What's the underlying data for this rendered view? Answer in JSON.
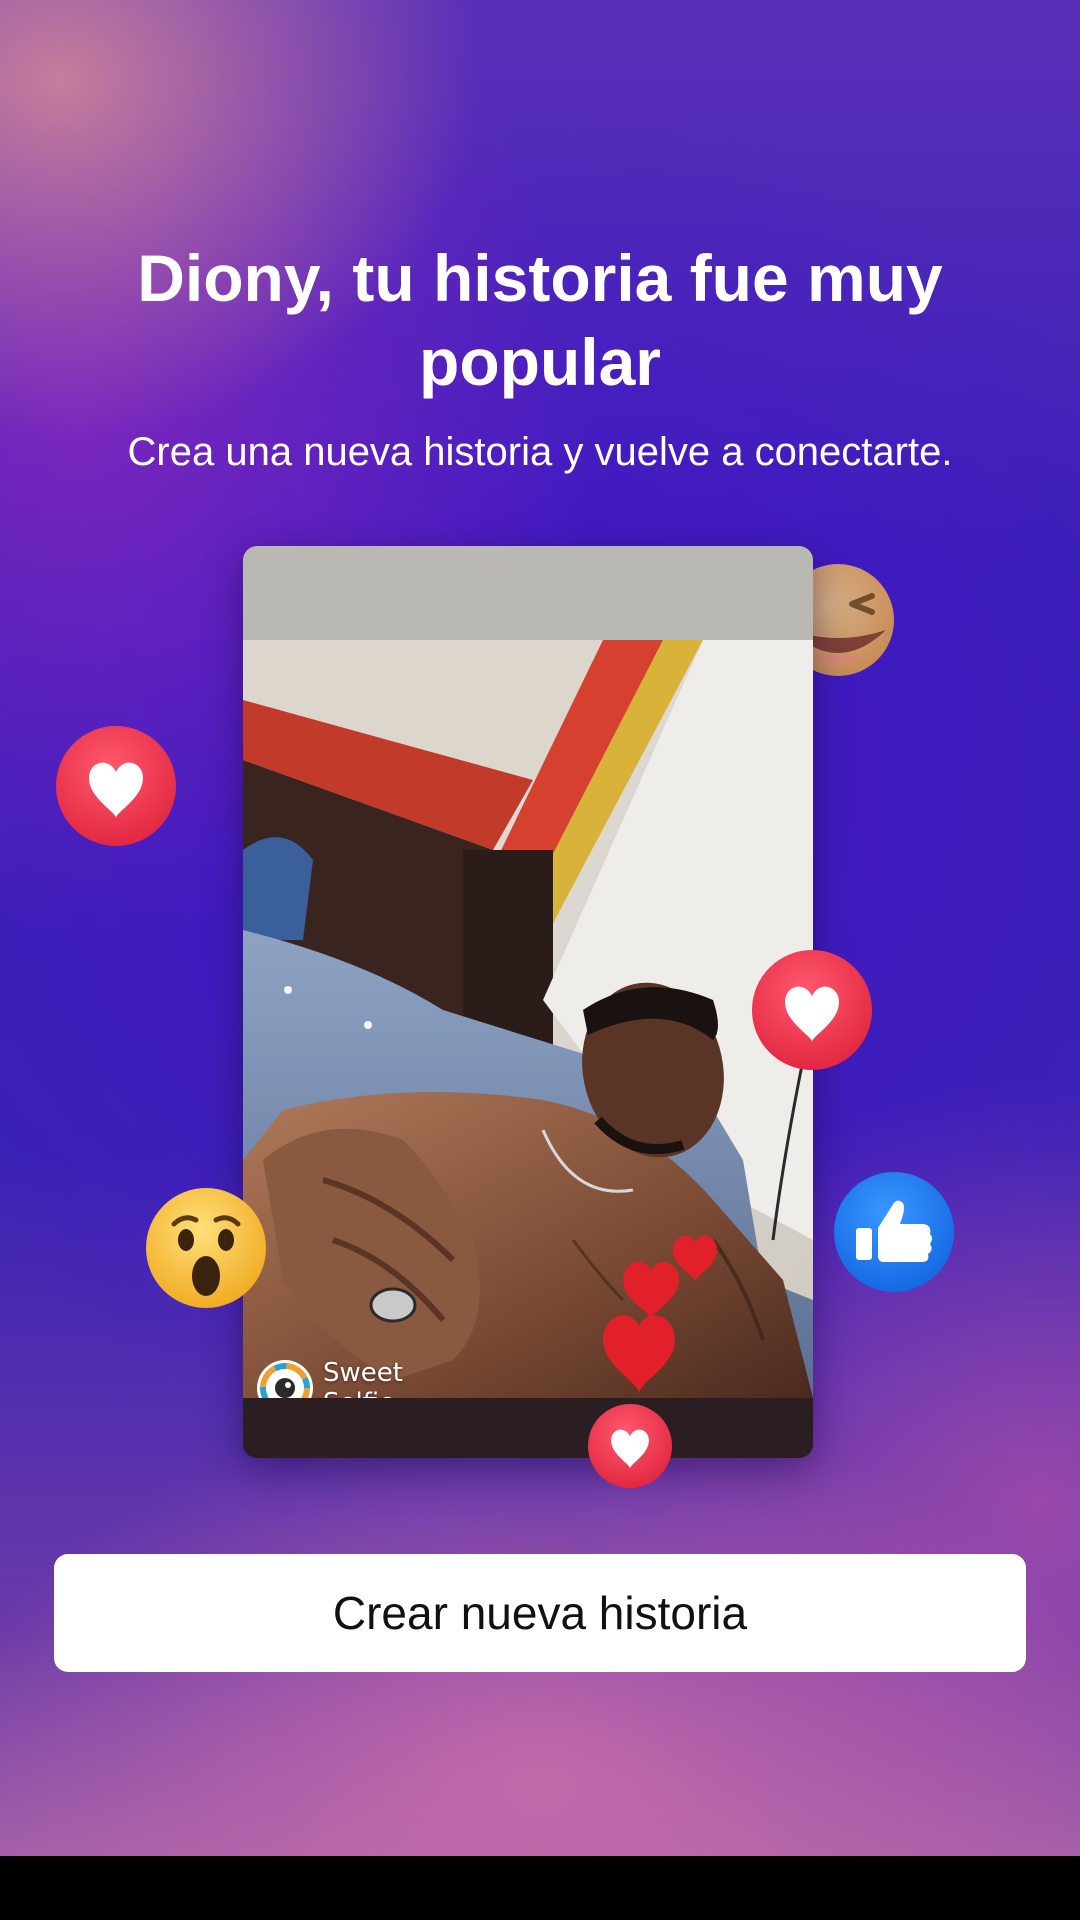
{
  "header": {
    "title": "Diony, tu historia fue muy popular",
    "subtitle": "Crea una nueva historia y vuelve a conectarte."
  },
  "story": {
    "watermark": "Sweet\nSelfie"
  },
  "reactions": [
    "heart-icon",
    "laugh-emoji-icon",
    "wow-emoji-icon",
    "like-icon"
  ],
  "actions": {
    "create_story_label": "Crear nueva historia"
  },
  "colors": {
    "reaction_red": "#f0364f",
    "like_blue": "#1877f2",
    "emoji_yellow": "#fbc531"
  }
}
